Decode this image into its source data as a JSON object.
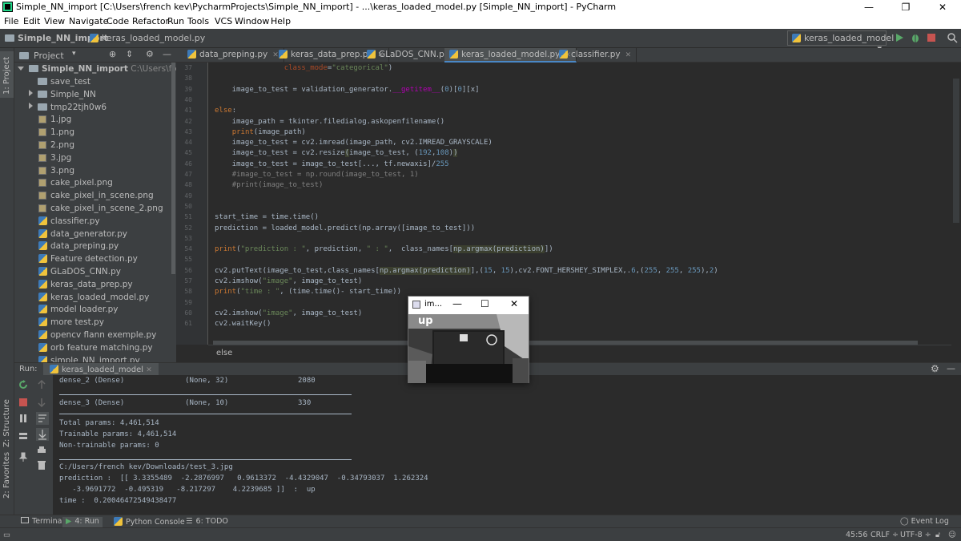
{
  "window": {
    "title": "Simple_NN_import [C:\\Users\\french kev\\PycharmProjects\\Simple_NN_import] - ...\\keras_loaded_model.py [Simple_NN_import] - PyCharm",
    "minimize": "—",
    "maximize": "❐",
    "close": "✕"
  },
  "menu": [
    "File",
    "Edit",
    "View",
    "Navigate",
    "Code",
    "Refactor",
    "Run",
    "Tools",
    "VCS",
    "Window",
    "Help"
  ],
  "nav": {
    "project": "Simple_NN_import",
    "file": "keras_loaded_model.py",
    "run_config": "keras_loaded_model"
  },
  "sidebar": {
    "project_tab": "1: Project",
    "structure_tab": "Z: Structure",
    "favorites_tab": "2: Favorites"
  },
  "project_panel": {
    "header": "Project",
    "root_name": "Simple_NN_import",
    "root_path": "C:\\Users\\french kev\\",
    "items": [
      {
        "label": "save_test",
        "type": "folder",
        "expand": ""
      },
      {
        "label": "Simple_NN",
        "type": "folder",
        "expand": "right"
      },
      {
        "label": "tmp22tjh0w6",
        "type": "folder",
        "expand": "right"
      },
      {
        "label": "1.jpg",
        "type": "img",
        "expand": ""
      },
      {
        "label": "1.png",
        "type": "img",
        "expand": ""
      },
      {
        "label": "2.png",
        "type": "img",
        "expand": ""
      },
      {
        "label": "3.jpg",
        "type": "img",
        "expand": ""
      },
      {
        "label": "3.png",
        "type": "img",
        "expand": ""
      },
      {
        "label": "cake_pixel.png",
        "type": "img",
        "expand": ""
      },
      {
        "label": "cake_pixel_in_scene.png",
        "type": "img",
        "expand": ""
      },
      {
        "label": "cake_pixel_in_scene_2.png",
        "type": "img",
        "expand": ""
      },
      {
        "label": "classifier.py",
        "type": "py",
        "expand": ""
      },
      {
        "label": "data_generator.py",
        "type": "py",
        "expand": ""
      },
      {
        "label": "data_preping.py",
        "type": "py",
        "expand": ""
      },
      {
        "label": "Feature detection.py",
        "type": "py",
        "expand": ""
      },
      {
        "label": "GLaDOS_CNN.py",
        "type": "py",
        "expand": ""
      },
      {
        "label": "keras_data_prep.py",
        "type": "py",
        "expand": ""
      },
      {
        "label": "keras_loaded_model.py",
        "type": "py",
        "expand": ""
      },
      {
        "label": "model loader.py",
        "type": "py",
        "expand": ""
      },
      {
        "label": "more test.py",
        "type": "py",
        "expand": ""
      },
      {
        "label": "opencv flann exemple.py",
        "type": "py",
        "expand": ""
      },
      {
        "label": "orb feature matching.py",
        "type": "py",
        "expand": ""
      },
      {
        "label": "simple_NN_import.py",
        "type": "py",
        "expand": ""
      }
    ]
  },
  "tabs": [
    {
      "label": "data_preping.py",
      "active": false
    },
    {
      "label": "keras_data_prep.py",
      "active": false
    },
    {
      "label": "GLaDOS_CNN.py",
      "active": false
    },
    {
      "label": "keras_loaded_model.py",
      "active": true
    },
    {
      "label": "classifier.py",
      "active": false
    }
  ],
  "editor": {
    "lines": [
      {
        "n": "37",
        "html": "                <span class=\"pp\">class_mode</span>=<span class=\"st\">\"categorical\"</span>)"
      },
      {
        "n": "38",
        "html": ""
      },
      {
        "n": "39",
        "html": "    image_to_test = validation_generator.<span class=\"fn\">__getitem__</span>(<span class=\"nm\">0</span>)[<span class=\"nm\">0</span>][x]"
      },
      {
        "n": "40",
        "html": ""
      },
      {
        "n": "41",
        "html": "<span class=\"kw\">else</span>:"
      },
      {
        "n": "42",
        "html": "    image_path = tkinter.filedialog.askopenfilename()"
      },
      {
        "n": "43",
        "html": "    <span class=\"kw\">print</span>(image_path)"
      },
      {
        "n": "44",
        "html": "    image_to_test = cv2.imread(image_path, cv2.IMREAD_GRAYSCALE)"
      },
      {
        "n": "45",
        "html": "    image_to_test = cv2.resize<span class=\"hl\">(</span>image_to_test, (<span class=\"nm\">192</span>,<span class=\"nm\">108</span>)<span class=\"hl\">)</span>"
      },
      {
        "n": "46",
        "html": "    image_to_test = image_to_test[..., tf.newaxis]/<span class=\"nm\">255</span>"
      },
      {
        "n": "47",
        "html": "    <span class=\"cm\">#image_to_test = np.round(image_to_test, 1)</span>"
      },
      {
        "n": "48",
        "html": "    <span class=\"cm\">#print(image_to_test)</span>"
      },
      {
        "n": "49",
        "html": ""
      },
      {
        "n": "50",
        "html": ""
      },
      {
        "n": "51",
        "html": "start_time = time.time()"
      },
      {
        "n": "52",
        "html": "prediction = loaded_model.predict(np.array([image_to_test]))"
      },
      {
        "n": "53",
        "html": ""
      },
      {
        "n": "54",
        "html": "<span class=\"kw\">print</span>(<span class=\"st\">\"prediction : \"</span>, prediction, <span class=\"st\">\" : \"</span>,  class_names[<span class=\"hl\">np.argmax(prediction)</span>])"
      },
      {
        "n": "55",
        "html": ""
      },
      {
        "n": "56",
        "html": "cv2.putText(image_to_test,class_names[<span class=\"hl\">np.argmax(prediction)</span>],(<span class=\"nm\">15</span>, <span class=\"nm\">15</span>),cv2.FONT_HERSHEY_SIMPLEX,.<span class=\"nm\">6</span>,(<span class=\"nm\">255</span>, <span class=\"nm\">255</span>, <span class=\"nm\">255</span>),<span class=\"nm\">2</span>)"
      },
      {
        "n": "57",
        "html": "cv2.imshow(<span class=\"st\">\"image\"</span>, image_to_test)"
      },
      {
        "n": "58",
        "html": "<span class=\"kw\">print</span>(<span class=\"st\">\"time : \"</span>, (time.time()- start_time))"
      },
      {
        "n": "59",
        "html": ""
      },
      {
        "n": "60",
        "html": "cv2.imshow(<span class=\"st\">\"image\"</span>, image_to_test)"
      },
      {
        "n": "61",
        "html": "cv2.waitKey()"
      }
    ],
    "breadcrumb": "else"
  },
  "run": {
    "label": "Run:",
    "config": "keras_loaded_model",
    "console": [
      {
        "t": "dense_2 (Dense)              (None, 32)                2080",
        "sep": false
      },
      {
        "t": "",
        "sep": true
      },
      {
        "t": "dense_3 (Dense)              (None, 10)                330",
        "sep": false
      },
      {
        "t": "",
        "sep": true
      },
      {
        "t": "Total params: 4,461,514",
        "sep": false
      },
      {
        "t": "Trainable params: 4,461,514",
        "sep": false
      },
      {
        "t": "Non-trainable params: 0",
        "sep": false
      },
      {
        "t": "",
        "sep": true
      },
      {
        "t": "C:/Users/french kev/Downloads/test_3.jpg",
        "sep": false
      },
      {
        "t": "prediction :  [[ 3.3355489  -2.2876997   0.9613372  -4.4329047  -0.34793037  1.262324",
        "sep": false
      },
      {
        "t": "   -3.9691772  -0.495319   -8.217297    4.2239685 ]]  :  up",
        "sep": false
      },
      {
        "t": "time :  0.20046472549438477",
        "sep": false
      }
    ]
  },
  "bottom_tabs": [
    {
      "label": "Terminal",
      "icon": "terminal-icon"
    },
    {
      "label": "4: Run",
      "icon": "run-icon"
    },
    {
      "label": "Python Console",
      "icon": "python-console-icon"
    },
    {
      "label": "6: TODO",
      "icon": "todo-icon"
    }
  ],
  "event_log": "Event Log",
  "status": {
    "position": "45:56",
    "line_sep": "CRLF ÷",
    "encoding": "UTF-8 ÷"
  },
  "image_window": {
    "title": "im...",
    "overlay_text": "up",
    "minimize": "—",
    "maximize": "☐",
    "close": "✕"
  },
  "colors": {
    "accent": "#4a88c7",
    "run_green": "#59a869",
    "stop_red": "#c75450"
  }
}
